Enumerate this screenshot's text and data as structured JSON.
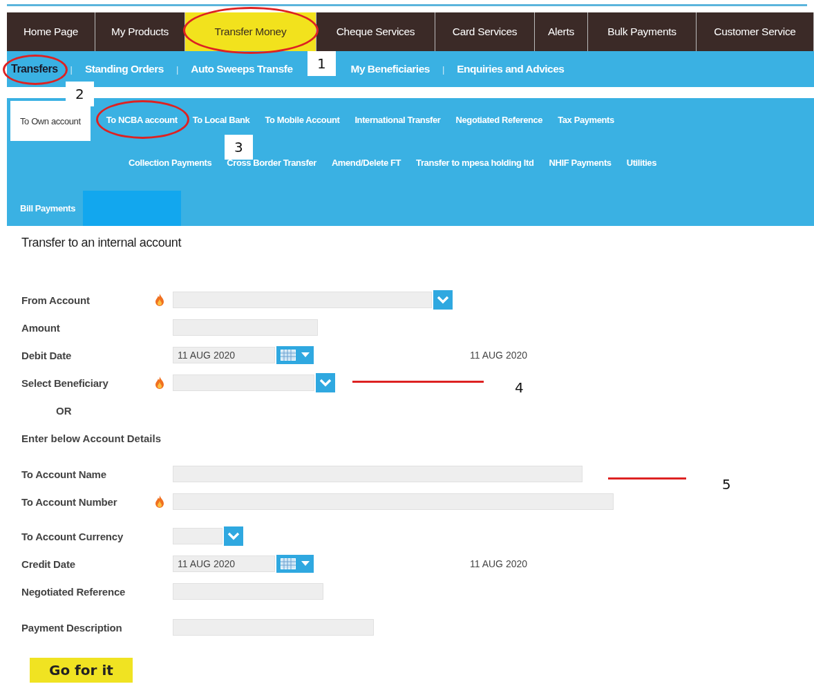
{
  "main_nav": [
    {
      "label": "Home Page",
      "selected": false,
      "circled": false
    },
    {
      "label": "My Products",
      "selected": false,
      "circled": false
    },
    {
      "label": "Transfer Money",
      "selected": true,
      "circled": true
    },
    {
      "label": "Cheque Services",
      "selected": false,
      "circled": false
    },
    {
      "label": "Card Services",
      "selected": false,
      "circled": false
    },
    {
      "label": "Alerts",
      "selected": false,
      "circled": false
    },
    {
      "label": "Bulk Payments",
      "selected": false,
      "circled": false
    },
    {
      "label": "Customer Service",
      "selected": false,
      "circled": false
    }
  ],
  "sub_nav": [
    {
      "kind": "link",
      "label": "Transfers",
      "selected": true,
      "circled": true
    },
    {
      "kind": "separator",
      "label": "|"
    },
    {
      "kind": "link",
      "label": "Standing Orders",
      "selected": false,
      "circled": false
    },
    {
      "kind": "separator",
      "label": "|"
    },
    {
      "kind": "link",
      "label": "Auto Sweeps Transfe",
      "selected": false,
      "circled": false
    },
    {
      "kind": "link",
      "label": "My Beneficiaries",
      "selected": false,
      "circled": false
    },
    {
      "kind": "separator",
      "label": "|"
    },
    {
      "kind": "link",
      "label": "Enquiries and Advices",
      "selected": false,
      "circled": false
    }
  ],
  "tab_rows": [
    {
      "tabs": [
        {
          "label": "To Own account",
          "selected": true,
          "circled": false
        },
        {
          "label": "To NCBA account",
          "selected": false,
          "circled": true
        },
        {
          "label": "To Local Bank",
          "selected": false,
          "circled": false
        },
        {
          "label": "To Mobile Account",
          "selected": false,
          "circled": false
        },
        {
          "label": "International Transfer",
          "selected": false,
          "circled": false
        },
        {
          "label": "Negotiated Reference",
          "selected": false,
          "circled": false
        },
        {
          "label": "Tax Payments",
          "selected": false,
          "circled": false
        }
      ]
    },
    {
      "tabs": [
        {
          "label": "Collection Payments",
          "selected": false,
          "circled": false
        },
        {
          "label": "Cross Border Transfer",
          "selected": false,
          "circled": false
        },
        {
          "label": "Amend/Delete FT",
          "selected": false,
          "circled": false
        },
        {
          "label": "Transfer to mpesa holding ltd",
          "selected": false,
          "circled": false
        },
        {
          "label": "NHIF Payments",
          "selected": false,
          "circled": false
        },
        {
          "label": "Utilities",
          "selected": false,
          "circled": false
        }
      ]
    },
    {
      "tabs": [
        {
          "label": "Bill Payments",
          "selected": false,
          "circled": false
        }
      ]
    }
  ],
  "form": {
    "title": "Transfer to an internal account",
    "rows": [
      {
        "kind": "select",
        "label": "From Account",
        "required": true
      },
      {
        "kind": "text",
        "label": "Amount",
        "required": false
      },
      {
        "kind": "date",
        "label": "Debit Date",
        "value": "11 AUG 2020",
        "echo": "11 AUG 2020",
        "required": false
      },
      {
        "kind": "select",
        "label": "Select Beneficiary",
        "required": true
      },
      {
        "kind": "note",
        "label": "OR"
      },
      {
        "kind": "heading",
        "label": "Enter below Account Details"
      },
      {
        "kind": "text",
        "label": "To Account Name",
        "required": false
      },
      {
        "kind": "text",
        "label": "To Account Number",
        "required": true
      },
      {
        "kind": "select",
        "label": "To Account Currency",
        "required": false
      },
      {
        "kind": "date",
        "label": "Credit Date",
        "value": "11 AUG 2020",
        "echo": "11 AUG 2020",
        "required": false
      },
      {
        "kind": "text",
        "label": "Negotiated Reference",
        "required": false
      },
      {
        "kind": "text",
        "label": "Payment Description",
        "required": false
      }
    ],
    "submit": "Go for it"
  },
  "callouts": [
    {
      "kind": "box",
      "number": "1"
    },
    {
      "kind": "box",
      "number": "2"
    },
    {
      "kind": "box",
      "number": "3"
    },
    {
      "kind": "pointer",
      "number": "4"
    },
    {
      "kind": "pointer",
      "number": "5"
    }
  ]
}
